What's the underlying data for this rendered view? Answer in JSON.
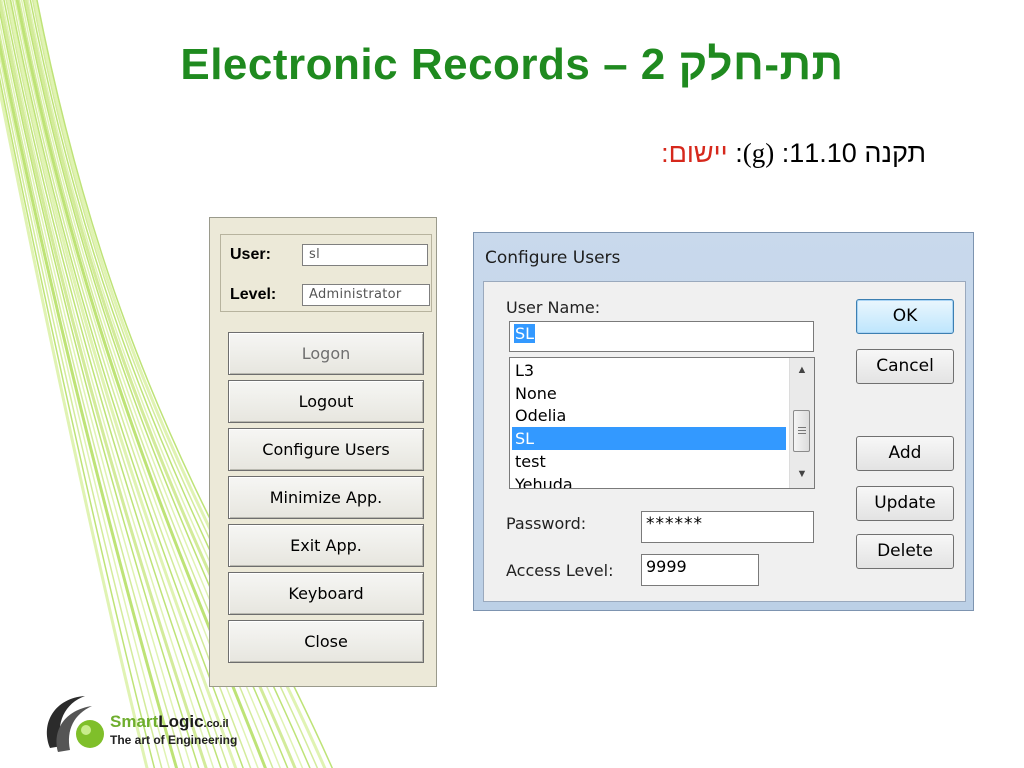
{
  "slide": {
    "title": "Electronic Records – 2 תת-חלק",
    "subtitle": {
      "prefix": "תקנה 11.10",
      "colon1": ":",
      "clause": "(g)",
      "colon2": ":",
      "label": "יישום:"
    }
  },
  "left_panel": {
    "user_label": "User:",
    "user_value": "sl",
    "level_label": "Level:",
    "level_value": "Administrator",
    "buttons": [
      {
        "label": "Logon",
        "enabled": false
      },
      {
        "label": "Logout",
        "enabled": true
      },
      {
        "label": "Configure Users",
        "enabled": true
      },
      {
        "label": "Minimize App.",
        "enabled": true
      },
      {
        "label": "Exit App.",
        "enabled": true
      },
      {
        "label": "Keyboard",
        "enabled": true
      },
      {
        "label": "Close",
        "enabled": true
      }
    ]
  },
  "dialog": {
    "title": "Configure Users",
    "user_name_label": "User Name:",
    "user_name_value": "SL",
    "user_list": [
      "L3",
      "None",
      "Odelia",
      "SL",
      "test",
      "Yehuda"
    ],
    "selected_user": "SL",
    "password_label": "Password:",
    "password_value": "******",
    "access_level_label": "Access Level:",
    "access_level_value": "9999",
    "buttons": {
      "ok": "OK",
      "cancel": "Cancel",
      "add": "Add",
      "update": "Update",
      "delete": "Delete"
    }
  },
  "logo": {
    "brand_green": "Smart",
    "brand_dark": "Logic",
    "brand_domain": ".co.il",
    "tagline": "The art of Engineering"
  },
  "colors": {
    "title_green": "#1f8a1f",
    "highlight_red": "#d6281c",
    "selection_blue": "#3399ff",
    "deco_lines": "#a8d94a"
  },
  "icons": {
    "scroll_up": "triangle-up-icon",
    "scroll_down": "triangle-down-icon",
    "logo_mark": "smartlogic-swirl-icon"
  }
}
